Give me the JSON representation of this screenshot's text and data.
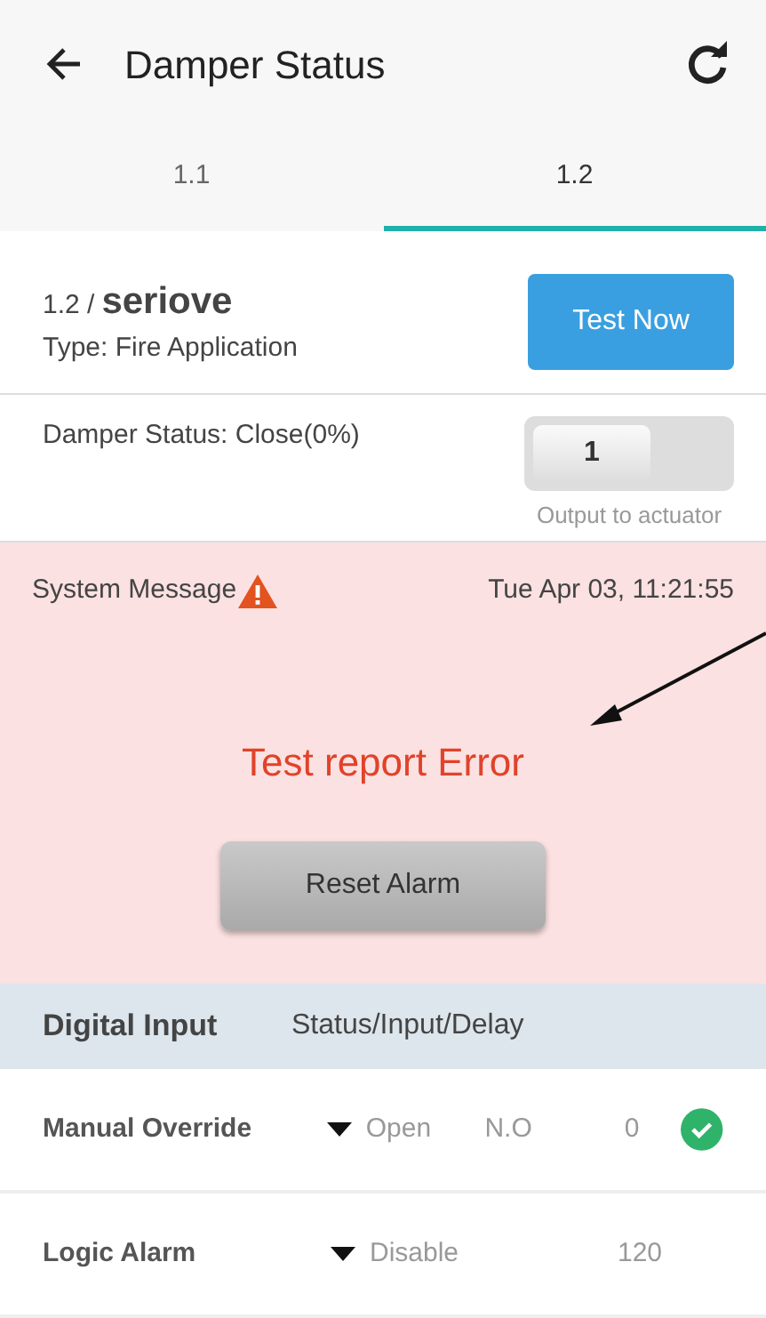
{
  "app_bar": {
    "title": "Damper Status"
  },
  "tabs": [
    {
      "label": "1.1",
      "selected": false
    },
    {
      "label": "1.2",
      "selected": true
    }
  ],
  "device": {
    "id": "1.2 /",
    "name": "seriove",
    "type": "Type: Fire Application",
    "button": "Test Now"
  },
  "damper": {
    "status": "Damper Status: Close(0%)",
    "switch_label": "1",
    "on": true,
    "caption": "Output to actuator"
  },
  "alarm": {
    "label": "System Message",
    "time": "Tue Apr 03, 11:21:55",
    "message": "Test report Error",
    "button": "Reset Alarm"
  },
  "digital_input": {
    "title": "Digital Input",
    "columns": "Status/Input/Delay",
    "rows": [
      {
        "name": "Manual Override",
        "status": "Open",
        "input": "N.O",
        "delay": "0",
        "ok": true
      },
      {
        "name": "Logic Alarm",
        "status": "Disable",
        "delay": "120",
        "ok": false
      }
    ]
  }
}
